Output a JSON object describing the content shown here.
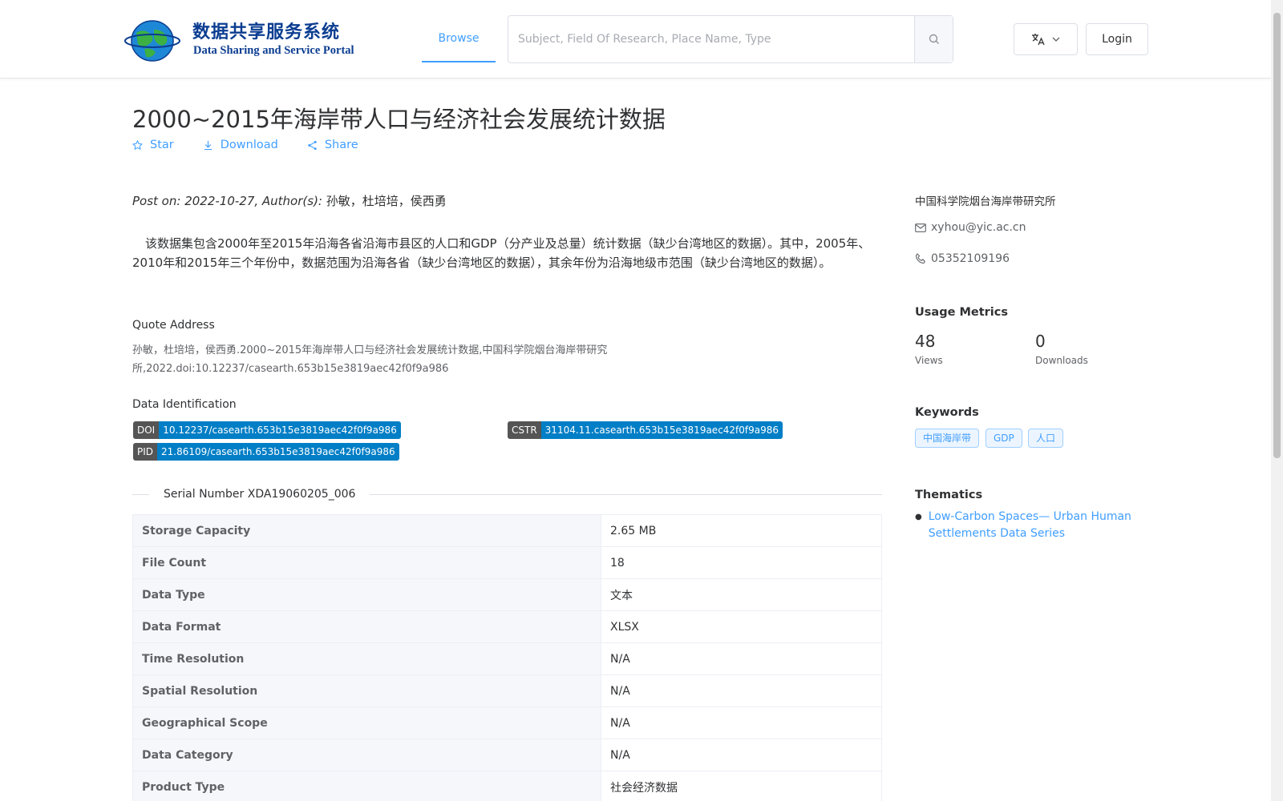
{
  "header": {
    "logo_cn": "数据共享服务系统",
    "logo_en": "Data Sharing and Service Portal",
    "nav_browse": "Browse",
    "search_placeholder": "Subject, Field Of Research, Place Name, Type",
    "login_label": "Login"
  },
  "dataset": {
    "title": "2000~2015年海岸带人口与经济社会发展统计数据",
    "actions": {
      "star": "Star",
      "download": "Download",
      "share": "Share"
    },
    "post_prefix": "Post on: 2022-10-27, Author(s): ",
    "authors": "孙敏，杜培培，侯西勇",
    "description": "该数据集包含2000年至2015年沿海各省沿海市县区的人口和GDP（分产业及总量）统计数据（缺少台湾地区的数据）。其中，2005年、2010年和2015年三个年份中，数据范围为沿海各省（缺少台湾地区的数据），其余年份为沿海地级市范围（缺少台湾地区的数据）。",
    "quote_label": "Quote Address",
    "quote_text": "孙敏，杜培培，侯西勇.2000~2015年海岸带人口与经济社会发展统计数据,中国科学院烟台海岸带研究所,2022.doi:10.12237/casearth.653b15e3819aec42f0f9a986",
    "ident_label": "Data Identification",
    "doi_key": "DOI",
    "doi_value": "10.12237/casearth.653b15e3819aec42f0f9a986",
    "cstr_key": "CSTR",
    "cstr_value": "31104.11.casearth.653b15e3819aec42f0f9a986",
    "pid_key": "PID",
    "pid_value": "21.86109/casearth.653b15e3819aec42f0f9a986",
    "serial": "Serial Number XDA19060205_006",
    "properties": [
      {
        "k": "Storage Capacity",
        "v": "2.65 MB"
      },
      {
        "k": "File Count",
        "v": "18"
      },
      {
        "k": "Data Type",
        "v": "文本"
      },
      {
        "k": "Data Format",
        "v": "XLSX"
      },
      {
        "k": "Time Resolution",
        "v": "N/A"
      },
      {
        "k": "Spatial Resolution",
        "v": "N/A"
      },
      {
        "k": "Geographical Scope",
        "v": "N/A"
      },
      {
        "k": "Data Category",
        "v": "N/A"
      },
      {
        "k": "Product Type",
        "v": "社会经济数据"
      }
    ]
  },
  "sidebar": {
    "institution": "中国科学院烟台海岸带研究所",
    "email": "xyhou@yic.ac.cn",
    "phone": "05352109196",
    "metrics_title": "Usage Metrics",
    "views_count": "48",
    "views_label": "Views",
    "downloads_count": "0",
    "downloads_label": "Downloads",
    "keywords_title": "Keywords",
    "keywords": [
      "中国海岸带",
      "GDP",
      "人口"
    ],
    "thematics_title": "Thematics",
    "thematic_item": "Low-Carbon Spaces— Urban Human Settlements Data Series"
  },
  "colors": {
    "accent": "#409eff",
    "badge_key": "#555555",
    "badge_value": "#007ec6",
    "logo_blue": "#0b3d91"
  }
}
